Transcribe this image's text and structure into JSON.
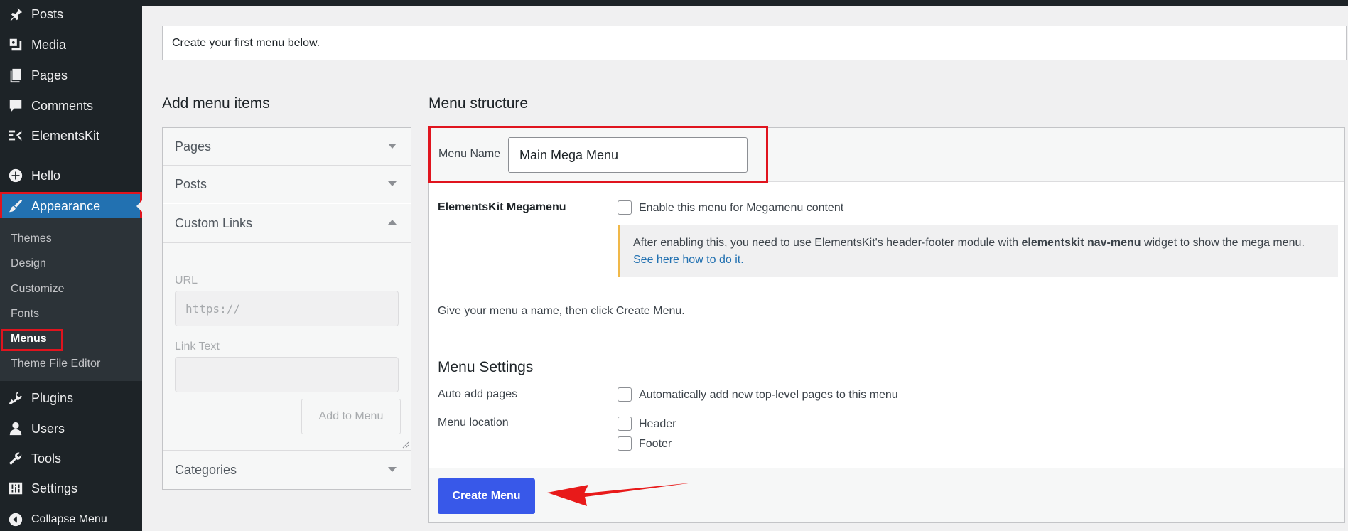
{
  "sidebar": {
    "items": [
      {
        "label": "Posts",
        "icon": "pin-icon"
      },
      {
        "label": "Media",
        "icon": "media-icon"
      },
      {
        "label": "Pages",
        "icon": "pages-icon"
      },
      {
        "label": "Comments",
        "icon": "comments-icon"
      },
      {
        "label": "ElementsKit",
        "icon": "elementskit-icon"
      },
      {
        "label": "Hello",
        "icon": "plus-circle-icon"
      },
      {
        "label": "Appearance",
        "icon": "brush-icon",
        "active": true
      },
      {
        "label": "Plugins",
        "icon": "plugin-icon"
      },
      {
        "label": "Users",
        "icon": "user-icon"
      },
      {
        "label": "Tools",
        "icon": "wrench-icon"
      },
      {
        "label": "Settings",
        "icon": "sliders-icon"
      },
      {
        "label": "Collapse Menu",
        "icon": "collapse-icon"
      }
    ],
    "submenu": [
      "Themes",
      "Design",
      "Customize",
      "Fonts",
      "Menus",
      "Theme File Editor"
    ],
    "current_submenu": "Menus"
  },
  "notice": "Create your first menu below.",
  "add_items": {
    "title": "Add menu items",
    "sections": [
      {
        "label": "Pages",
        "open": false
      },
      {
        "label": "Posts",
        "open": false
      },
      {
        "label": "Custom Links",
        "open": true
      },
      {
        "label": "Categories",
        "open": false
      }
    ],
    "url_label": "URL",
    "url_placeholder": "https://",
    "link_text_label": "Link Text",
    "add_button": "Add to Menu"
  },
  "structure": {
    "title": "Menu structure",
    "menu_name_label": "Menu Name",
    "menu_name_value": "Main Mega Menu",
    "megamenu_label": "ElementsKit Megamenu",
    "megamenu_checkbox": "Enable this menu for Megamenu content",
    "info_pre": "After enabling this, you need to use ElementsKit's header-footer module with ",
    "info_bold": "elementskit nav-menu",
    "info_post": " widget to show the mega menu.",
    "info_link": "See here how to do it.",
    "hint": "Give your menu a name, then click Create Menu.",
    "settings_title": "Menu Settings",
    "auto_add_label": "Auto add pages",
    "auto_add_checkbox": "Automatically add new top-level pages to this menu",
    "location_label": "Menu location",
    "locations": [
      "Header",
      "Footer"
    ],
    "create_button": "Create Menu"
  },
  "colors": {
    "sidebar_bg": "#1d2327",
    "active_bg": "#2271b1",
    "primary_button": "#3858e9",
    "highlight_red": "#e0141e",
    "notice_border": "#f0b849"
  }
}
